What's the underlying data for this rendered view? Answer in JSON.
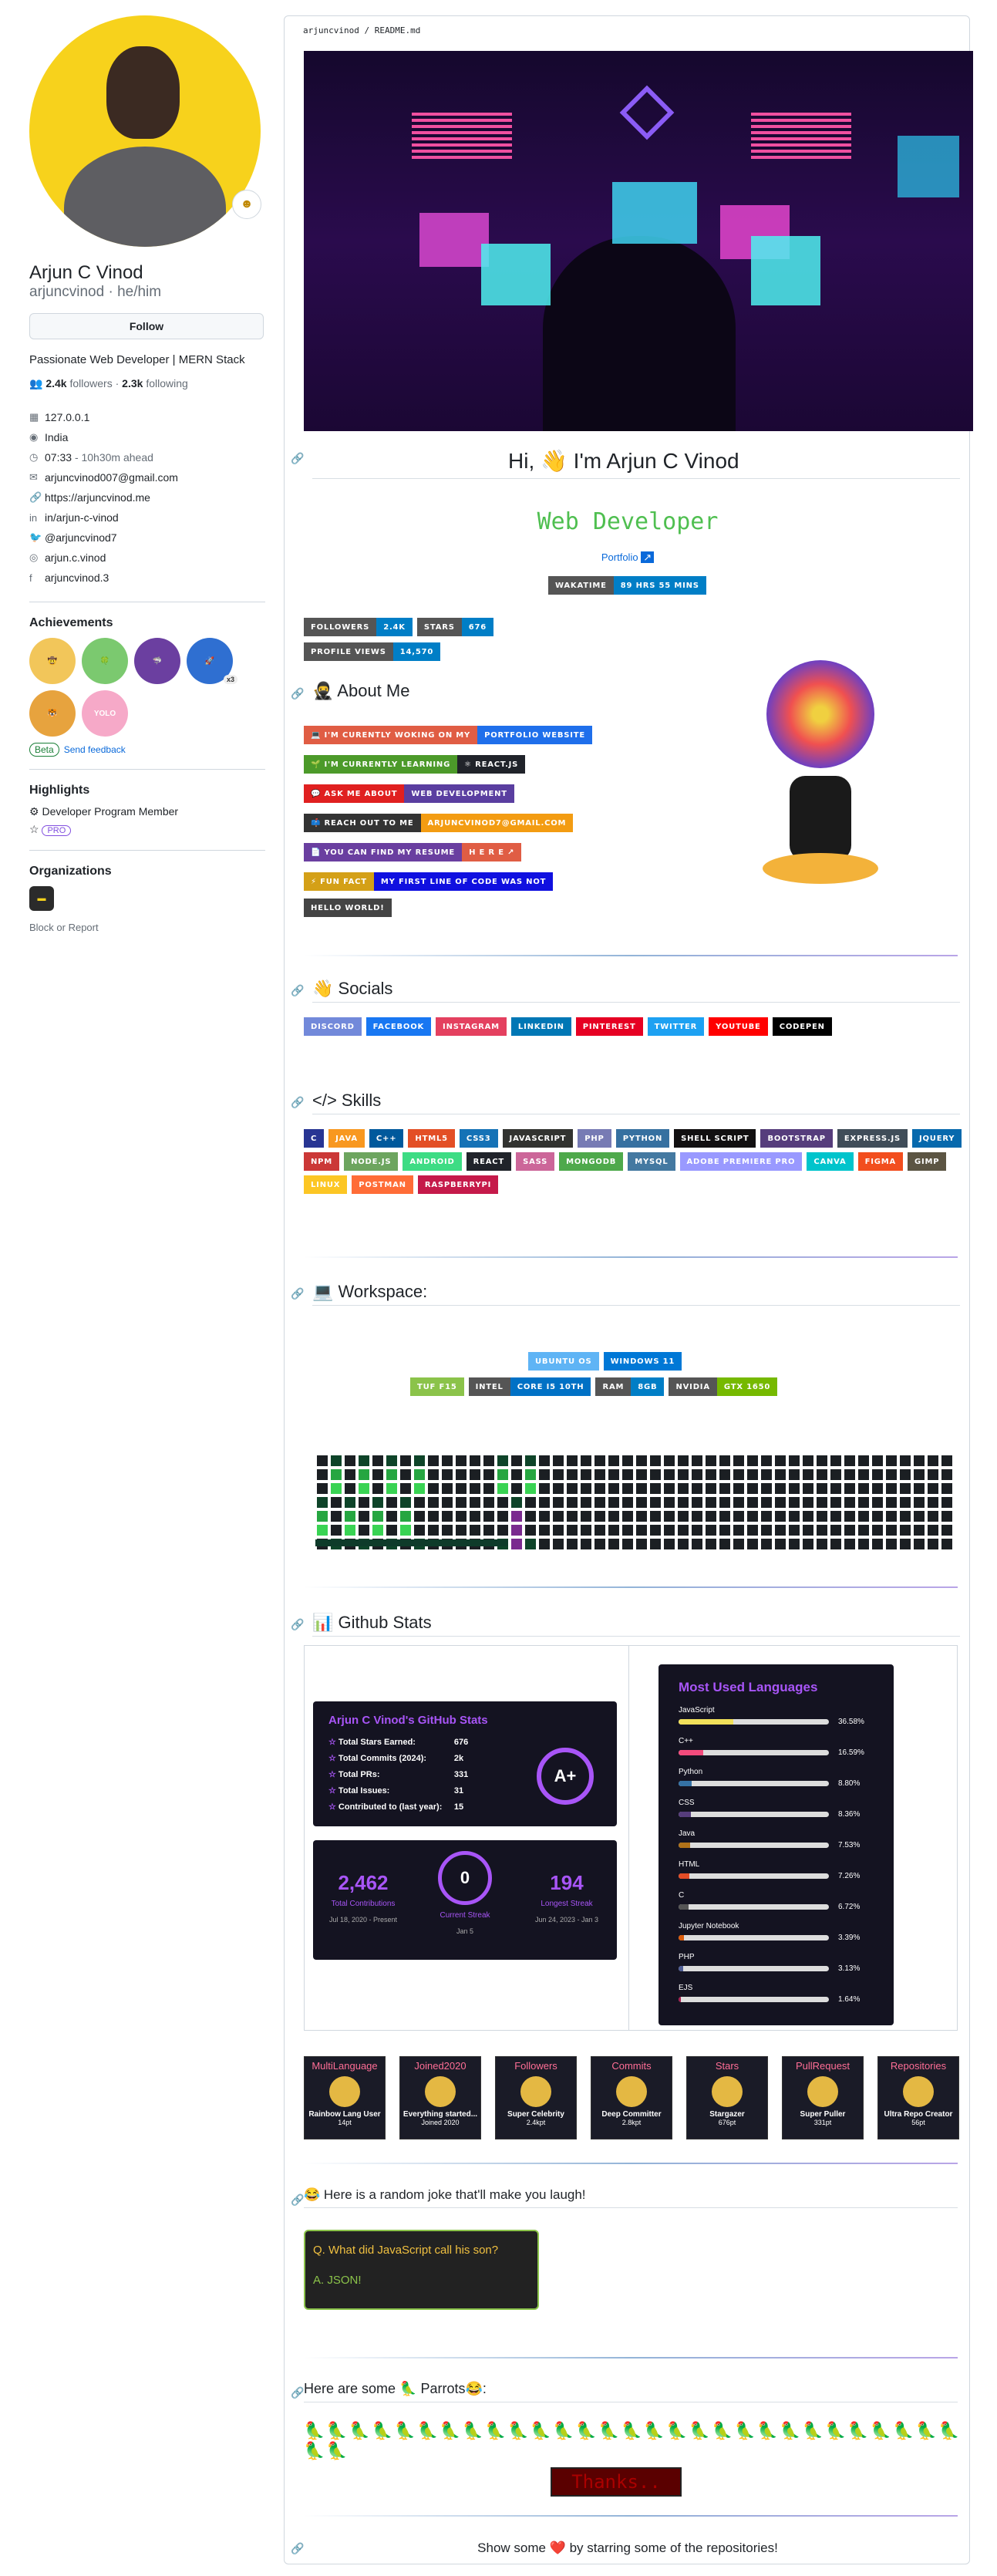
{
  "profile": {
    "name": "Arjun C Vinod",
    "login": "arjuncvinod",
    "pronouns": "he/him",
    "follow": "Follow",
    "bio": "Passionate Web Developer | MERN Stack",
    "followers": "2.4k",
    "followers_label": "followers",
    "following": "2.3k",
    "following_label": "following",
    "dot": "·"
  },
  "meta": [
    {
      "icon": "building-icon",
      "text": "127.0.0.1"
    },
    {
      "icon": "location-icon",
      "text": "India"
    },
    {
      "icon": "clock-icon",
      "text": "07:33",
      "extra": "- 10h30m ahead"
    },
    {
      "icon": "mail-icon",
      "text": "arjuncvinod007@gmail.com"
    },
    {
      "icon": "link-icon",
      "text": "https://arjuncvinod.me"
    },
    {
      "icon": "linkedin-icon",
      "text": "in/arjun-c-vinod"
    },
    {
      "icon": "twitter-icon",
      "text": "@arjuncvinod7"
    },
    {
      "icon": "instagram-icon",
      "text": "arjun.c.vinod"
    },
    {
      "icon": "facebook-icon",
      "text": "arjuncvinod.3"
    }
  ],
  "achievements": {
    "title": "Achievements",
    "count": "x3",
    "beta": "Beta",
    "feedback": "Send feedback"
  },
  "highlights": {
    "title": "Highlights",
    "member": "Developer Program Member",
    "pro": "PRO"
  },
  "orgs": {
    "title": "Organizations",
    "block": "Block or Report"
  },
  "readme": {
    "path": "arjuncvinod / README.md",
    "hi": "Hi,",
    "wave": "👋",
    "name": "I'm Arjun C Vinod",
    "role": "Web Developer",
    "portfolio": "Portfolio",
    "wakatime": [
      "WAKATIME",
      "89 HRS 55 MINS"
    ],
    "followers": [
      "FOLLOWERS",
      "2.4K"
    ],
    "stars": [
      "STARS",
      "676"
    ],
    "views": [
      "PROFILE VIEWS",
      "14,570"
    ],
    "about": "About Me",
    "aboutrows": [
      [
        "💻 I'M CURENTLY WOKING ON MY",
        "PORTFOLIO WEBSITE"
      ],
      [
        "🌱 I'M CURRENTLY LEARNING",
        "⚛ REACT.JS"
      ],
      [
        "💬 ASK ME ABOUT",
        "WEB DEVELOPMENT"
      ],
      [
        "📫 REACH OUT TO ME",
        "ARJUNCVINOD7@GMAIL.COM"
      ],
      [
        "📄 YOU CAN FIND MY RESUME",
        "H E R E ↗"
      ],
      [
        "⚡ FUN FACT",
        "MY FIRST LINE OF CODE WAS NOT"
      ],
      [
        "HELLO WORLD!"
      ]
    ],
    "socials": "Socials",
    "socials_list": [
      "DISCORD",
      "FACEBOOK",
      "INSTAGRAM",
      "LINKEDIN",
      "PINTEREST",
      "TWITTER",
      "YOUTUBE",
      "CODEPEN"
    ],
    "skills": "Skills",
    "skills_list": [
      "C",
      "JAVA",
      "C++",
      "HTML5",
      "CSS3",
      "JAVASCRIPT",
      "PHP",
      "PYTHON",
      "SHELL SCRIPT",
      "BOOTSTRAP",
      "EXPRESS.JS",
      "JQUERY",
      "NPM",
      "NODE.JS",
      "ANDROID",
      "REACT",
      "SASS",
      "MONGODB",
      "MYSQL",
      "ADOBE PREMIERE PRO",
      "CANVA",
      "FIGMA",
      "GIMP",
      "LINUX",
      "POSTMAN",
      "RASPBERRYPI"
    ],
    "workspace": "Workspace:",
    "ws1": [
      "UBUNTU OS",
      "WINDOWS 11"
    ],
    "ws2": [
      "TUF F15",
      "INTEL",
      "CORE I5 10TH",
      "RAM",
      "8GB",
      "NVIDIA",
      "GTX 1650"
    ],
    "stats": "Github Stats",
    "statcard": {
      "title": "Arjun C Vinod's GitHub Stats",
      "rows": [
        [
          "Total Stars Earned:",
          "676"
        ],
        [
          "Total Commits (2024):",
          "2k"
        ],
        [
          "Total PRs:",
          "331"
        ],
        [
          "Total Issues:",
          "31"
        ],
        [
          "Contributed to (last year):",
          "15"
        ]
      ],
      "grade": "A+"
    },
    "streak": {
      "total": "2,462",
      "total_l": "Total Contributions",
      "total_d": "Jul 18, 2020 - Present",
      "cur": "0",
      "cur_l": "Current Streak",
      "cur_d": "Jan 5",
      "long": "194",
      "long_l": "Longest Streak",
      "long_d": "Jun 24, 2023 - Jan 3"
    },
    "langs": {
      "title": "Most Used Languages",
      "items": [
        [
          "JavaScript",
          "36.58%",
          36.58,
          "#f1e05a"
        ],
        [
          "C++",
          "16.59%",
          16.59,
          "#f34b7d"
        ],
        [
          "Python",
          "8.80%",
          8.8,
          "#3572A5"
        ],
        [
          "CSS",
          "8.36%",
          8.36,
          "#563d7c"
        ],
        [
          "Java",
          "7.53%",
          7.53,
          "#b07219"
        ],
        [
          "HTML",
          "7.26%",
          7.26,
          "#e34c26"
        ],
        [
          "C",
          "6.72%",
          6.72,
          "#555555"
        ],
        [
          "Jupyter Notebook",
          "3.39%",
          3.39,
          "#DA5B0B"
        ],
        [
          "PHP",
          "3.13%",
          3.13,
          "#4F5D95"
        ],
        [
          "EJS",
          "1.64%",
          1.64,
          "#a91e50"
        ]
      ]
    },
    "trophies": [
      [
        "MultiLanguage",
        "Rainbow Lang User",
        "14pt"
      ],
      [
        "Joined2020",
        "Everything started...",
        "Joined 2020"
      ],
      [
        "Followers",
        "Super Celebrity",
        "2.4kpt"
      ],
      [
        "Commits",
        "Deep Committer",
        "2.8kpt"
      ],
      [
        "Stars",
        "Stargazer",
        "676pt"
      ],
      [
        "PullRequest",
        "Super Puller",
        "331pt"
      ],
      [
        "Repositories",
        "Ultra Repo Creator",
        "56pt"
      ]
    ],
    "joke_h": "😂 Here is a random joke that'll make you laugh!",
    "joke_q": "Q. What did JavaScript call his son?",
    "joke_a": "A. JSON!",
    "parrots_h": "Here are some 🦜 Parrots😂:",
    "thanks": "Thanks..",
    "footer": "Show some ❤️ by starring some of the repositories!"
  }
}
